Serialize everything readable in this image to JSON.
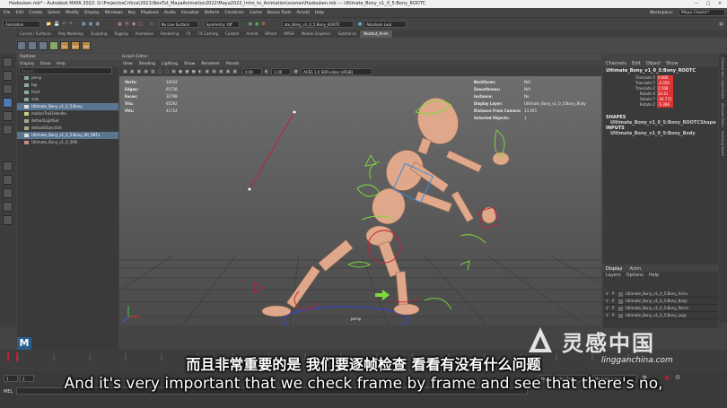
{
  "titlebar": {
    "title": "Hadouken.mb* - Autodesk MAYA 2022: G:\\ProjectosCritica\\2021\\NexTut_MayaAnimation2022\\Maya2022_Intro_to_Animation\\scenes\\Hadouken.mb --- Ultimate_Bony_v1_0_5:Bony_ROOTC"
  },
  "menubar": {
    "items": [
      "File",
      "Edit",
      "Create",
      "Select",
      "Modify",
      "Display",
      "Windows",
      "Key",
      "Playback",
      "Audio",
      "Visualize",
      "Deform",
      "Constrain",
      "Cache",
      "Bonus Tools",
      "Arnold",
      "Help"
    ],
    "workspace_label": "Workspace:",
    "workspace_value": "Maya Classic*"
  },
  "statusline": {
    "mode": "Animation",
    "no_live_surface": "No Live Surface",
    "symmetry": "Symmetry: Off",
    "object_field": "ate_Bony_v1_0_5:Bony_ROOTC",
    "user": "Abraham Leal"
  },
  "shelf": {
    "tabs": [
      "Curves / Surfaces",
      "Poly Modeling",
      "Sculpting",
      "Rigging",
      "Animation",
      "Rendering",
      "FX",
      "FX Caching",
      "Custom",
      "Arnold",
      "Bifrost",
      "MASH",
      "Motion Graphics",
      "Substance",
      "Nexttut_Anim"
    ],
    "active_tab": "Nexttut_Anim",
    "icon_labels": [
      "",
      "",
      "",
      "",
      "Pos Tgl",
      "Walk",
      "MW"
    ]
  },
  "outliner": {
    "title": "Outliner",
    "menu": [
      "Display",
      "Show",
      "Help"
    ],
    "search_placeholder": "Search...",
    "items": [
      {
        "label": "persp",
        "selected": false
      },
      {
        "label": "top",
        "selected": false
      },
      {
        "label": "front",
        "selected": false
      },
      {
        "label": "side",
        "selected": false
      },
      {
        "label": "Ultimate_Bony_v1_0_5:Bony",
        "selected": true
      },
      {
        "label": "motionTrail1Handle",
        "selected": false
      },
      {
        "label": "defaultLightSet",
        "selected": false
      },
      {
        "label": "defaultObjectSet",
        "selected": false
      },
      {
        "label": "Ultimate_Bony_v1_0_5:Bony_All_CNTx",
        "selected": true
      },
      {
        "label": "Ultimate_Bony_v1_0_5RN",
        "selected": false
      }
    ]
  },
  "viewport": {
    "panel_title": "Graph Editor",
    "menu": [
      "View",
      "Shading",
      "Lighting",
      "Show",
      "Renderer",
      "Panels"
    ],
    "field_a": "0.00",
    "field_b": "1.00",
    "colorspace": "ACES 1.0 SDR-video (sRGB)",
    "camera_label": "persp",
    "stats_left": [
      {
        "k": "Verts:",
        "v": "33032"
      },
      {
        "k": "Edges:",
        "v": "65738"
      },
      {
        "k": "Faces:",
        "v": "32798"
      },
      {
        "k": "Tris:",
        "v": "65592"
      },
      {
        "k": "UVs:",
        "v": "41714"
      }
    ],
    "stats_right": [
      {
        "k": "Backfaces:",
        "v": "N/A"
      },
      {
        "k": "Smoothness:",
        "v": "N/A"
      },
      {
        "k": "Instance:",
        "v": "No"
      },
      {
        "k": "Display Layer:",
        "v": "Ultimate_Bony_v1_0_5:Bony_Body"
      },
      {
        "k": "Distance From Camera:",
        "v": "13.945"
      },
      {
        "k": "Selected Objects:",
        "v": "1"
      }
    ]
  },
  "channelbox": {
    "menu": [
      "Channels",
      "Edit",
      "Object",
      "Show"
    ],
    "object_name": "Ultimate_Bony_v1_0_5:Bony_ROOTC",
    "attributes": [
      {
        "label": "Translate X",
        "value": "0.606"
      },
      {
        "label": "Translate Y",
        "value": "-2.056"
      },
      {
        "label": "Translate Z",
        "value": "1.568"
      },
      {
        "label": "Rotate X",
        "value": "24.41"
      },
      {
        "label": "Rotate Y",
        "value": "-34.772"
      },
      {
        "label": "Rotate Z",
        "value": "-5.368"
      }
    ],
    "shapes_header": "SHAPES",
    "shape_name": "Ultimate_Bony_v1_0_5:Bony_ROOTCShape",
    "inputs_header": "INPUTS",
    "input_name": "Ultimate_Bony_v1_0_5:Bony_Body"
  },
  "layereditor": {
    "tabs": [
      "Display",
      "Anim"
    ],
    "menu": [
      "Layers",
      "Options",
      "Help"
    ],
    "layers": [
      "Ultimate_Bony_v1_0_5:Bony_Arms",
      "Ultimate_Bony_v1_0_5:Bony_Body",
      "Ultimate_Bony_v1_0_5:Bony_Pelvis",
      "Ultimate_Bony_v1_0_5:Bony_Legs"
    ]
  },
  "sidetabs": [
    "Channel Box / Layer Editor",
    "Attribute Editor",
    "Modeling Toolkit"
  ],
  "timeline": {
    "start_field": "1",
    "end_field": "1",
    "character_set": "No Character Set",
    "anim_layer": "No Anim Layer"
  },
  "bottom": {
    "mel_label": "MEL"
  },
  "subtitles": {
    "line_cn": "而且非常重要的是 我们要逐帧检查 看看有没有什么问题",
    "line_en": "And it's very important that we check frame by frame and see that there's no,"
  },
  "watermark": {
    "cn": "灵感中国",
    "url": "lingganchina.com"
  },
  "colors": {
    "selection": "#5a7590",
    "skin": "#e0a88a",
    "control_green": "#7ddc3a",
    "control_red": "#c0203a",
    "accent_blue": "#4a7ab0"
  }
}
